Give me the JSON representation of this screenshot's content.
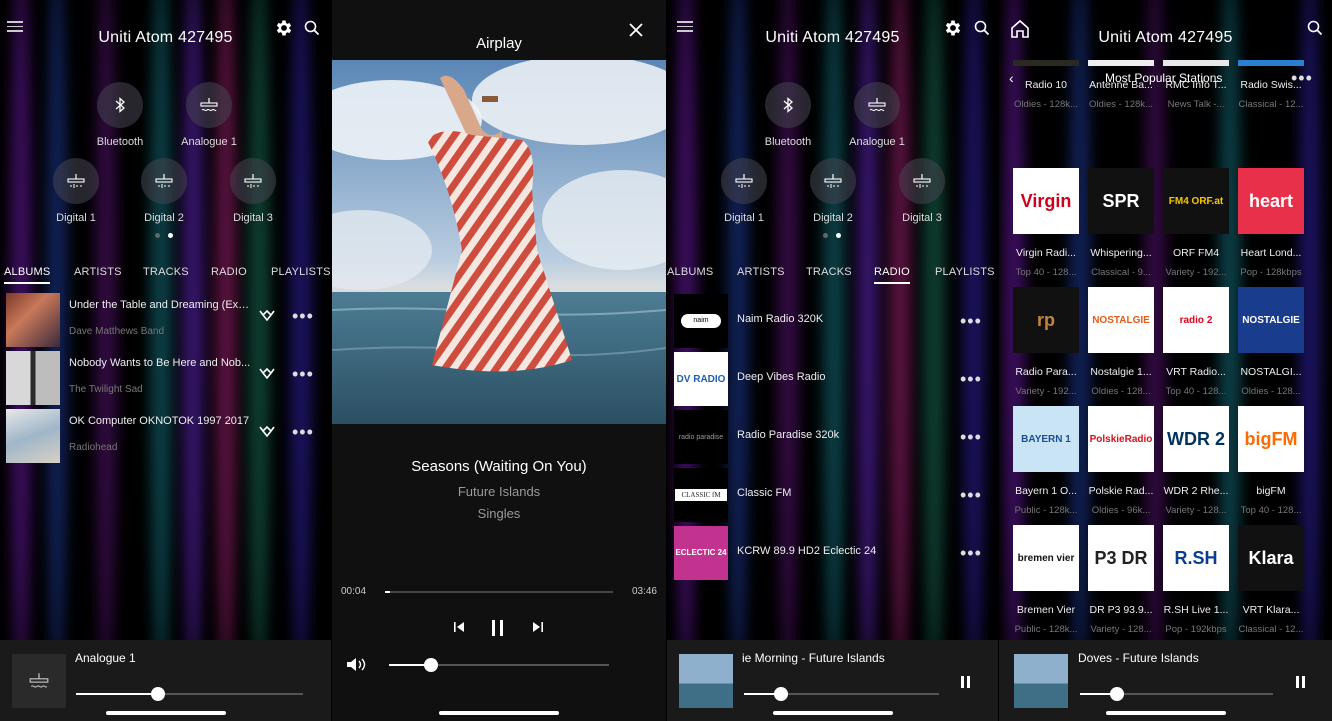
{
  "panel1": {
    "title": "Uniti Atom 427495",
    "sources_row1": [
      {
        "label": "Bluetooth",
        "icon": "bluetooth-icon"
      },
      {
        "label": "Analogue 1",
        "icon": "analogue-input-icon"
      }
    ],
    "sources_row2": [
      {
        "label": "Digital 1",
        "icon": "digital-input-icon"
      },
      {
        "label": "Digital 2",
        "icon": "digital-input-icon"
      },
      {
        "label": "Digital 3",
        "icon": "digital-input-icon"
      }
    ],
    "tabs": [
      "ALBUMS",
      "ARTISTS",
      "TRACKS",
      "RADIO",
      "PLAYLISTS"
    ],
    "active_tab": "ALBUMS",
    "albums": [
      {
        "title": "Under the Table and Dreaming (Exp...",
        "artist": "Dave Matthews Band"
      },
      {
        "title": "Nobody Wants to Be Here and Nob...",
        "artist": "The Twilight Sad"
      },
      {
        "title": "OK Computer OKNOTOK 1997 2017",
        "artist": "Radiohead"
      }
    ],
    "now_playing": {
      "title": "Analogue 1",
      "volume": 0.36
    }
  },
  "panel2": {
    "title": "Airplay",
    "track": "Seasons (Waiting On You)",
    "artist": "Future Islands",
    "album": "Singles",
    "elapsed": "00:04",
    "duration": "03:46",
    "progress": 0.02,
    "volume": 0.19
  },
  "panel3": {
    "title": "Uniti Atom 427495",
    "sources_row1": [
      {
        "label": "Bluetooth",
        "icon": "bluetooth-icon"
      },
      {
        "label": "Analogue 1",
        "icon": "analogue-input-icon"
      }
    ],
    "sources_row2": [
      {
        "label": "Digital 1",
        "icon": "digital-input-icon"
      },
      {
        "label": "Digital 2",
        "icon": "digital-input-icon"
      },
      {
        "label": "Digital 3",
        "icon": "digital-input-icon"
      }
    ],
    "tabs": [
      "ALBUMS",
      "ARTISTS",
      "TRACKS",
      "RADIO",
      "PLAYLISTS"
    ],
    "active_tab": "RADIO",
    "stations": [
      {
        "name": "Naim Radio 320K",
        "logo_text": "naim records"
      },
      {
        "name": "Deep Vibes Radio",
        "logo_text": "DV RADIO"
      },
      {
        "name": "Radio Paradise 320k",
        "logo_text": "radio paradise"
      },
      {
        "name": "Classic FM",
        "logo_text": "CLASSIC fM"
      },
      {
        "name": "KCRW 89.9 HD2 Eclectic 24",
        "logo_text": "ECLECTIC 24"
      }
    ],
    "now_playing": {
      "title": "ie Morning - Future Islands",
      "volume": 0.19
    }
  },
  "panel4": {
    "title": "Uniti Atom 427495",
    "section": "Most Popular Stations",
    "stations": [
      {
        "name": "Radio 10",
        "sub": "Oldies - 128k...",
        "logo": "",
        "bg": "#2a2a20",
        "fg": "#ddd"
      },
      {
        "name": "Antenne Ba...",
        "sub": "Oldies - 128k...",
        "logo": "",
        "bg": "#eeeeee",
        "fg": "#c00"
      },
      {
        "name": "RMC Info T...",
        "sub": "News Talk -...",
        "logo": "",
        "bg": "#e8e8e8",
        "fg": "#333"
      },
      {
        "name": "Radio Swis...",
        "sub": "Classical - 12...",
        "logo": "",
        "bg": "#2b7fd0",
        "fg": "#fff"
      },
      {
        "name": "Virgin Radi...",
        "sub": "Top 40 - 128...",
        "logo": "Virgin",
        "bg": "#ffffff",
        "fg": "#d0021b"
      },
      {
        "name": "Whispering...",
        "sub": "Classical - 9...",
        "logo": "SPR",
        "bg": "#111111",
        "fg": "#fff"
      },
      {
        "name": "ORF FM4",
        "sub": "Variety - 192...",
        "logo": "FM4 ORF.at",
        "bg": "#111111",
        "fg": "#f7c800"
      },
      {
        "name": "Heart Lond...",
        "sub": "Pop - 128kbps",
        "logo": "heart",
        "bg": "#e8304a",
        "fg": "#fff"
      },
      {
        "name": "Radio Para...",
        "sub": "Variety - 192...",
        "logo": "rp",
        "bg": "#111111",
        "fg": "#c6843a"
      },
      {
        "name": "Nostalgie 1...",
        "sub": "Oldies - 128...",
        "logo": "NOSTALGIE",
        "bg": "#ffffff",
        "fg": "#e75a16"
      },
      {
        "name": "VRT Radio...",
        "sub": "Top 40 - 128...",
        "logo": "radio 2",
        "bg": "#ffffff",
        "fg": "#e2001a"
      },
      {
        "name": "NOSTALGI...",
        "sub": "Oldies - 128...",
        "logo": "NOSTALGIE",
        "bg": "#1a3c8c",
        "fg": "#fff"
      },
      {
        "name": "Bayern 1 O...",
        "sub": "Public - 128k...",
        "logo": "BAYERN 1",
        "bg": "#c9e4f5",
        "fg": "#1d4d97"
      },
      {
        "name": "Polskie Rad...",
        "sub": "Oldies - 96k...",
        "logo": "PolskieRadio",
        "bg": "#ffffff",
        "fg": "#d6101a"
      },
      {
        "name": "WDR 2 Rhe...",
        "sub": "Variety - 128...",
        "logo": "WDR 2",
        "bg": "#ffffff",
        "fg": "#00345e"
      },
      {
        "name": "bigFM",
        "sub": "Top 40 - 128...",
        "logo": "bigFM",
        "bg": "#ffffff",
        "fg": "#ff6a00"
      },
      {
        "name": "Bremen Vier",
        "sub": "Public - 128k...",
        "logo": "bremen vier",
        "bg": "#ffffff",
        "fg": "#111"
      },
      {
        "name": "DR P3 93.9...",
        "sub": "Variety - 128...",
        "logo": "P3 DR",
        "bg": "#ffffff",
        "fg": "#222"
      },
      {
        "name": "R.SH Live 1...",
        "sub": "Pop - 192kbps",
        "logo": "R.SH",
        "bg": "#ffffff",
        "fg": "#0a3d8f"
      },
      {
        "name": "VRT Klara...",
        "sub": "Classical - 12...",
        "logo": "Klara",
        "bg": "#111111",
        "fg": "#fff"
      }
    ],
    "now_playing": {
      "title": "Doves - Future Islands",
      "volume": 0.19
    }
  }
}
